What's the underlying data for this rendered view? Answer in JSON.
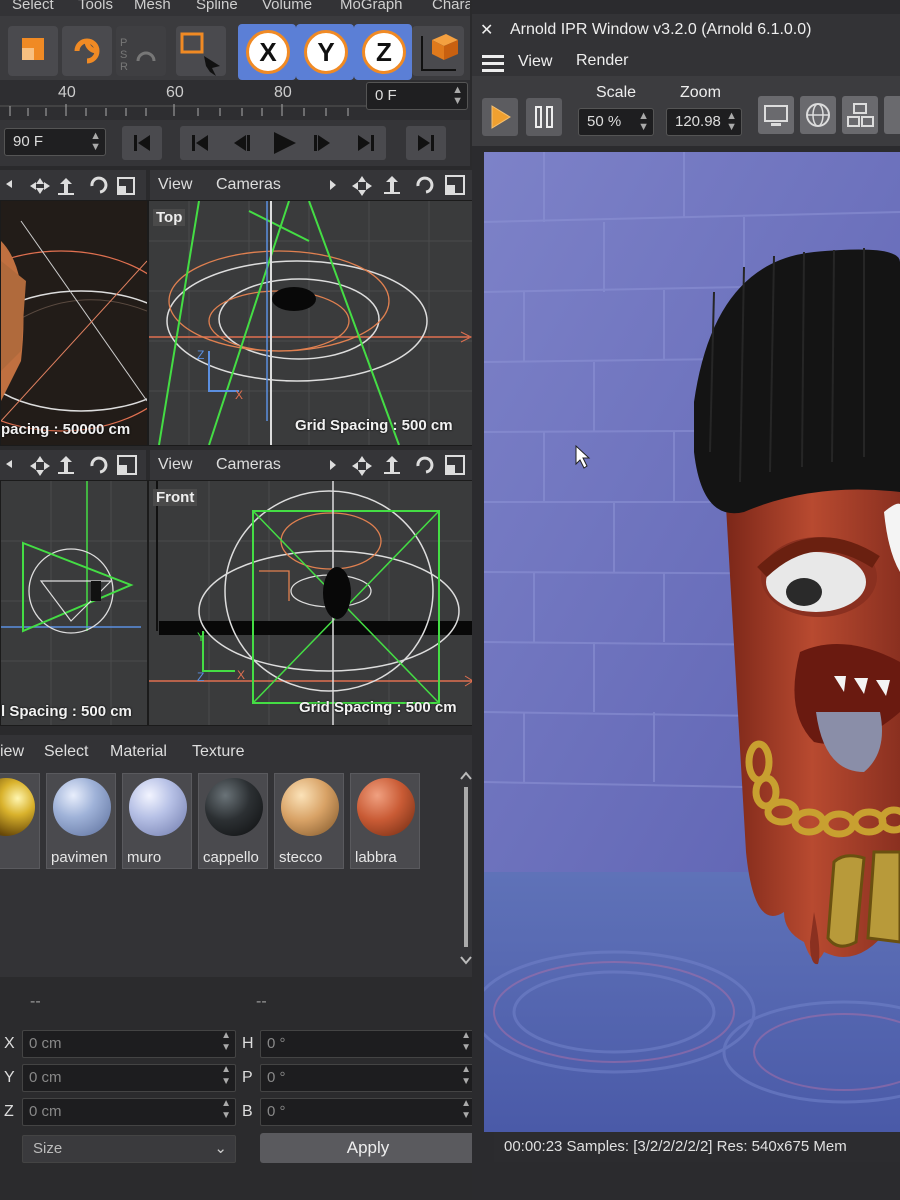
{
  "menu": {
    "items": [
      "Select",
      "Tools",
      "Mesh",
      "Spline",
      "Volume",
      "MoGraph",
      "Character"
    ]
  },
  "timeline": {
    "ticks": [
      "40",
      "60",
      "80"
    ],
    "current_frame": "0 F",
    "end_frame": "90 F"
  },
  "viewport_menu": {
    "view": "View",
    "cameras": "Cameras"
  },
  "viewports": {
    "persp_grid": "pacing : 50000 cm",
    "top_label": "Top",
    "top_grid": "Grid Spacing : 500 cm",
    "right_grid": "l Spacing : 500 cm",
    "front_label": "Front",
    "front_grid": "Grid Spacing : 500 cm"
  },
  "material_manager": {
    "menu": [
      "iew",
      "Select",
      "Material",
      "Texture"
    ],
    "materials": [
      {
        "name": "",
        "color": "#c9a22a"
      },
      {
        "name": "pavimen",
        "color": "#9fb2d8"
      },
      {
        "name": "muro",
        "color": "#b7c1e6"
      },
      {
        "name": "cappello",
        "color": "#2c3033"
      },
      {
        "name": "stecco",
        "color": "#d8a266"
      },
      {
        "name": "labbra",
        "color": "#c95b35"
      }
    ]
  },
  "attributes": {
    "dash_left": "--",
    "dash_right": "--",
    "x_label": "X",
    "x_value": "0 cm",
    "y_label": "Y",
    "y_value": "0 cm",
    "z_label": "Z",
    "z_value": "0 cm",
    "h_label": "H",
    "h_value": "0 °",
    "p_label": "P",
    "p_value": "0 °",
    "b_label": "B",
    "b_value": "0 °",
    "mode_select": "Size",
    "apply_button": "Apply"
  },
  "arnold": {
    "title": "Arnold IPR Window v3.2.0 (Arnold 6.1.0.0)",
    "close_glyph": "✕",
    "menu_view": "View",
    "menu_render": "Render",
    "scale_label": "Scale",
    "scale_value": "50 %",
    "zoom_label": "Zoom",
    "zoom_value": "120.98",
    "status": "00:00:23  Samples: [3/2/2/2/2/2]  Res: 540x675  Mem"
  },
  "colors": {
    "accent": "#f08a24",
    "axis_blue": "#5b7fd6",
    "wall": "#6d73c4"
  }
}
